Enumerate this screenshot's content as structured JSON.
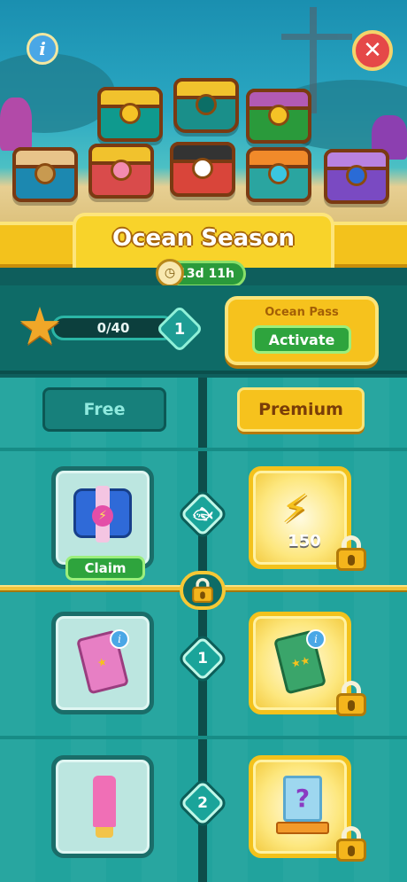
{
  "header": {
    "title": "Ocean Season",
    "timer": "13d 11h",
    "info_icon": "info-icon",
    "close_icon": "close-icon",
    "info_glyph": "i",
    "close_glyph": "✕"
  },
  "pass": {
    "progress_text": "0/40",
    "progress_value": 0,
    "level": "1",
    "label": "Ocean Pass",
    "button": "Activate"
  },
  "tracks": {
    "free_label": "Free",
    "premium_label": "Premium"
  },
  "rows": [
    {
      "marker_icon": "fish-icon",
      "free": {
        "reward": "lightning-chest",
        "action": "Claim"
      },
      "premium": {
        "reward": "lightning-bolts",
        "amount": "150",
        "locked": true
      }
    },
    {
      "marker": "1",
      "free": {
        "reward": "pink-card-pack",
        "info": true
      },
      "premium": {
        "reward": "green-card-pack",
        "info": true,
        "locked": true
      }
    },
    {
      "marker": "2",
      "free": {
        "reward": "pink-tube"
      },
      "premium": {
        "reward": "mystery-box",
        "locked": true
      }
    }
  ],
  "colors": {
    "accent_gold": "#f6c21d",
    "teal": "#21a39d",
    "green_button": "#2ea43d"
  }
}
